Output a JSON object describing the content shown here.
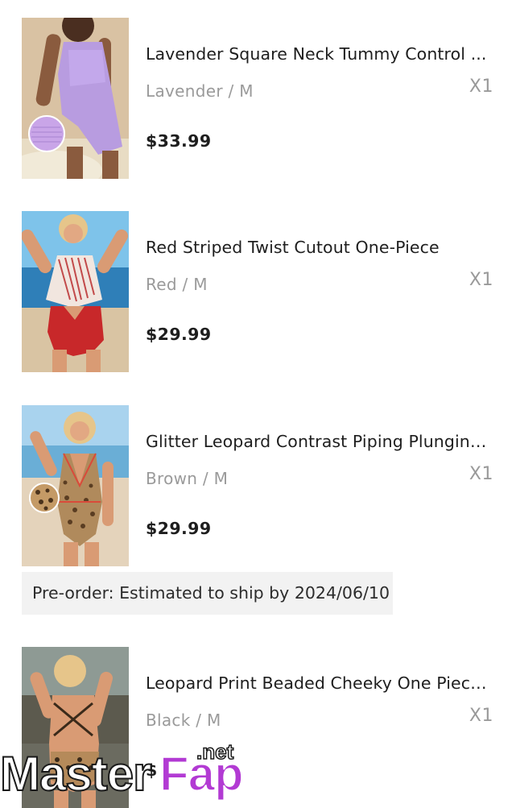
{
  "cart": {
    "items": [
      {
        "title": "Lavender Square Neck Tummy Control ...",
        "variant": "Lavender / M",
        "quantity": "X1",
        "price": "$33.99",
        "swatch_color": "#c9a5e8"
      },
      {
        "title": "Red Striped Twist Cutout One-Piece",
        "variant": "Red / M",
        "quantity": "X1",
        "price": "$29.99",
        "swatch_color": "#c8282a"
      },
      {
        "title": "Glitter Leopard Contrast Piping Plunging...",
        "variant": "Brown / M",
        "quantity": "X1",
        "price": "$29.99",
        "swatch_color": "#b08a5c",
        "preorder_note": "Pre-order: Estimated to ship by 2024/06/10"
      },
      {
        "title": "Leopard Print Beaded Cheeky One Piece...",
        "variant": "Black / M",
        "quantity": "X1",
        "price": "$",
        "swatch_color": "#7a5a3a"
      }
    ]
  },
  "watermark": {
    "part1": "Master",
    "part2": "Fap",
    "part3": ".net",
    "accent": "#b23ad3"
  }
}
